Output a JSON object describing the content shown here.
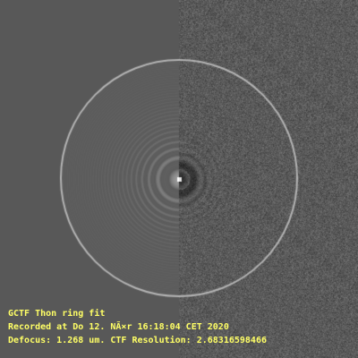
{
  "caption": {
    "title": "GCTF Thon ring fit",
    "recorded": "Recorded at Do 12. NÃ×r 16:18:04 CET 2020",
    "metrics": "Defocus: 1.268 um.  CTF Resolution: 2.68316598466"
  },
  "colors": {
    "caption_text": "#ffff66",
    "background": "#585858",
    "ring": "#b4b4b4"
  }
}
